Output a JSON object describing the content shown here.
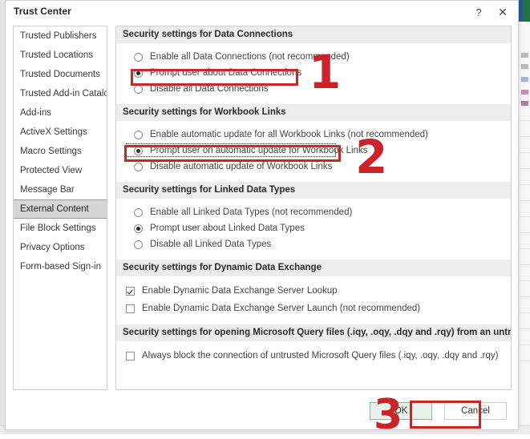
{
  "window": {
    "title": "Trust Center",
    "help_icon": "?",
    "close_icon": "✕",
    "help_icon_name": "help-icon",
    "close_icon_name": "close-icon"
  },
  "sidebar": {
    "items": [
      {
        "label": "Trusted Publishers",
        "selected": false
      },
      {
        "label": "Trusted Locations",
        "selected": false
      },
      {
        "label": "Trusted Documents",
        "selected": false
      },
      {
        "label": "Trusted Add-in Catalogs",
        "selected": false
      },
      {
        "label": "Add-ins",
        "selected": false
      },
      {
        "label": "ActiveX Settings",
        "selected": false
      },
      {
        "label": "Macro Settings",
        "selected": false
      },
      {
        "label": "Protected View",
        "selected": false
      },
      {
        "label": "Message Bar",
        "selected": false
      },
      {
        "label": "External Content",
        "selected": true
      },
      {
        "label": "File Block Settings",
        "selected": false
      },
      {
        "label": "Privacy Options",
        "selected": false
      },
      {
        "label": "Form-based Sign-in",
        "selected": false
      }
    ]
  },
  "sections": [
    {
      "header": "Security settings for Data Connections",
      "options": [
        {
          "type": "radio",
          "checked": false,
          "label": "Enable all Data Connections (not recommended)"
        },
        {
          "type": "radio",
          "checked": true,
          "label": "Prompt user about Data Connections"
        },
        {
          "type": "radio",
          "checked": false,
          "label": "Disable all Data Connections"
        }
      ]
    },
    {
      "header": "Security settings for Workbook Links",
      "options": [
        {
          "type": "radio",
          "checked": false,
          "label": "Enable automatic update for all Workbook Links (not recommended)"
        },
        {
          "type": "radio",
          "checked": true,
          "label": "Prompt user on automatic update for Workbook Links"
        },
        {
          "type": "radio",
          "checked": false,
          "label": "Disable automatic update of Workbook Links"
        }
      ]
    },
    {
      "header": "Security settings for Linked Data Types",
      "options": [
        {
          "type": "radio",
          "checked": false,
          "label": "Enable all Linked Data Types (not recommended)"
        },
        {
          "type": "radio",
          "checked": true,
          "label": "Prompt user about Linked Data Types"
        },
        {
          "type": "radio",
          "checked": false,
          "label": "Disable all Linked Data Types"
        }
      ]
    },
    {
      "header": "Security settings for Dynamic Data Exchange",
      "options": [
        {
          "type": "checkbox",
          "checked": true,
          "label": "Enable Dynamic Data Exchange Server Lookup"
        },
        {
          "type": "checkbox",
          "checked": false,
          "label": "Enable Dynamic Data Exchange Server Launch (not recommended)"
        }
      ]
    },
    {
      "header": "Security settings for opening  Microsoft Query files (.iqy, .oqy, .dqy and .rqy) from an untrusted source",
      "options": [
        {
          "type": "checkbox",
          "checked": false,
          "label": "Always block the connection of untrusted Microsoft Query files (.iqy, .oqy, .dqy and .rqy)"
        }
      ]
    }
  ],
  "footer": {
    "ok_label": "OK",
    "cancel_label": "Cancel"
  },
  "annotations": {
    "step1": "1",
    "step2": "2",
    "step3": "3",
    "color": "#cc2229"
  }
}
